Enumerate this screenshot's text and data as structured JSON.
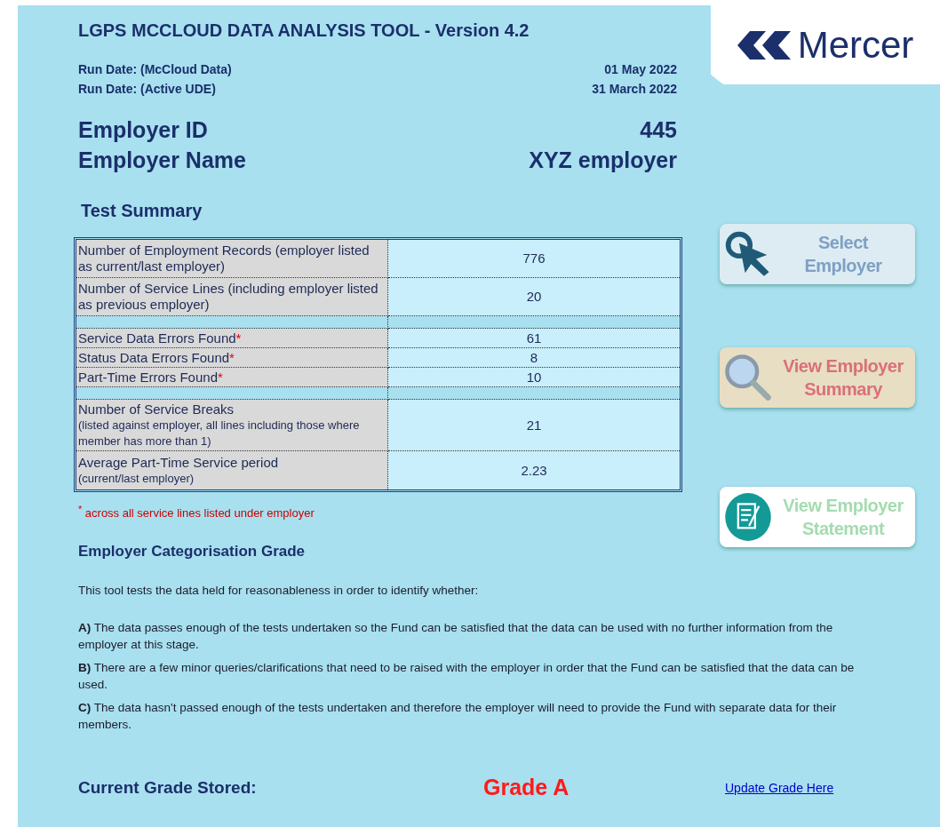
{
  "header": {
    "title": "LGPS MCCLOUD DATA ANALYSIS TOOL - Version 4.2",
    "logo": "Mercer"
  },
  "run_dates": [
    {
      "label": "Run Date: (McCloud Data)",
      "value": "01 May 2022"
    },
    {
      "label": "Run Date: (Active UDE)",
      "value": "31 March 2022"
    }
  ],
  "employer": [
    {
      "label": "Employer ID",
      "value": "445"
    },
    {
      "label": "Employer Name",
      "value": "XYZ employer"
    }
  ],
  "test_summary": {
    "title": "Test Summary",
    "rows": [
      {
        "kind": "row",
        "label": "Number of Employment Records (employer listed as current/last employer)",
        "value": "776"
      },
      {
        "kind": "row",
        "label": "Number of Service Lines (including employer listed as previous employer)",
        "value": "20"
      },
      {
        "kind": "spacer"
      },
      {
        "kind": "row",
        "label": "Service Data Errors Found",
        "mark": "*",
        "value": "61"
      },
      {
        "kind": "row",
        "label": "Status Data Errors Found",
        "mark": "*",
        "value": "8"
      },
      {
        "kind": "row",
        "label": "Part-Time Errors Found",
        "mark": "*",
        "value": "10"
      },
      {
        "kind": "spacer"
      },
      {
        "kind": "row",
        "label": "Number of Service Breaks",
        "note": "(listed against employer, all lines including those where member has more than 1)",
        "value": "21"
      },
      {
        "kind": "row",
        "label": "Average Part-Time Service period",
        "note": "(current/last employer)",
        "value": "2.23"
      }
    ],
    "footnote": "$^{*}$ across all service lines listed under employer"
  },
  "grade": {
    "title": "Employer Categorisation Grade",
    "intro": "This tool tests the data held for reasonableness in order to identify whether:",
    "options": [
      "**A)** The data passes enough of the tests undertaken so the Fund can be satisfied that the data can be used with no further information from the employer at this stage.",
      "**B)** There are a few minor queries/clarifications that need to be raised with the employer in order that the Fund can be satisfied that the data can be used.",
      "**C)** The data hasn't passed enough of the tests undertaken and therefore the employer will need to provide the Fund with separate data for their members."
    ],
    "current_label": "Current Grade Stored:",
    "current_value": "Grade A",
    "update_link": "Update Grade Here"
  },
  "buttons": [
    {
      "kind": "select",
      "line1": "Select",
      "line2": "Employer"
    },
    {
      "kind": "summary",
      "line1": "View Employer",
      "line2": "Summary"
    },
    {
      "kind": "statement",
      "line1": "View Employer",
      "line2": "Statement"
    }
  ]
}
